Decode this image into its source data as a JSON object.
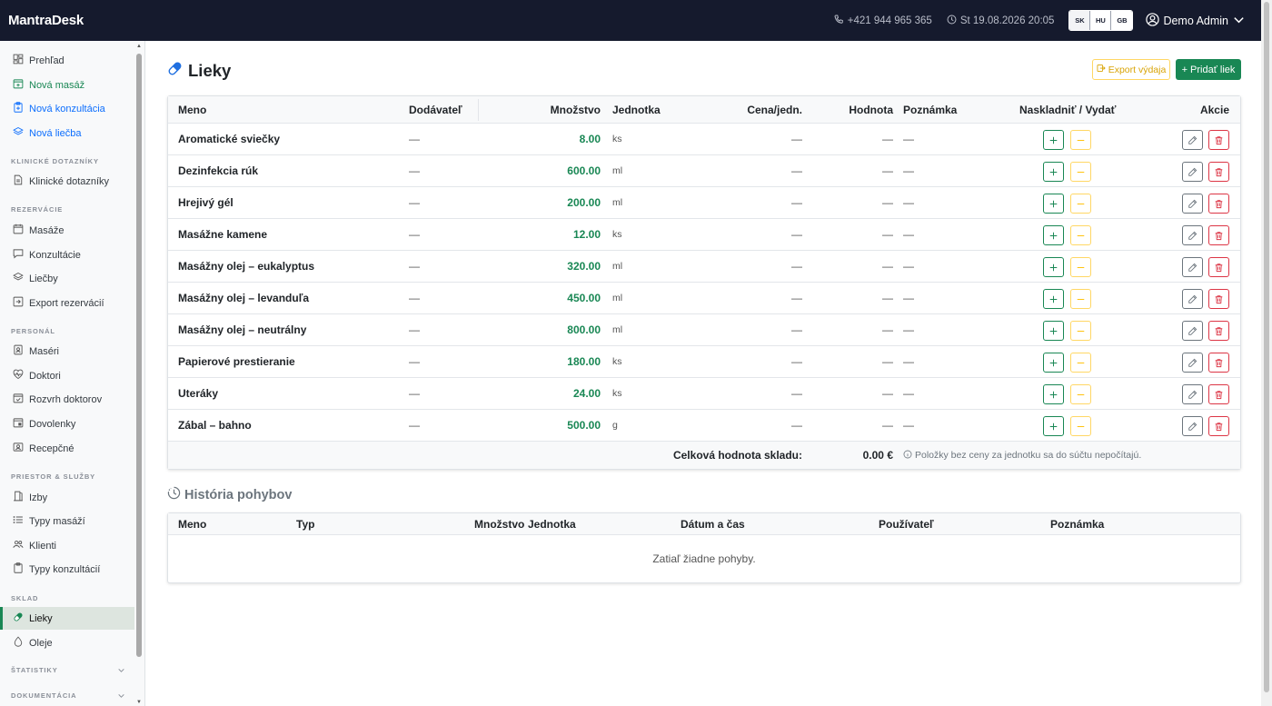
{
  "topbar": {
    "brand": "MantraDesk",
    "phone": "+421 944 965 365",
    "datetime": "St 19.08.2026 20:05",
    "languages": [
      "SK",
      "HU",
      "GB"
    ],
    "user": "Demo Admin"
  },
  "sidebar": {
    "items": [
      {
        "label": "Prehľad",
        "icon": "dashboard-icon"
      },
      {
        "label": "Nová masáž",
        "icon": "calendar-plus-icon"
      },
      {
        "label": "Nová konzultácia",
        "icon": "clipboard-plus-icon"
      },
      {
        "label": "Nová liečba",
        "icon": "layers-icon"
      },
      {
        "label": "Klinické dotazníky",
        "icon": "document-icon"
      },
      {
        "label": "Masáže",
        "icon": "calendar-icon"
      },
      {
        "label": "Konzultácie",
        "icon": "chat-icon"
      },
      {
        "label": "Liečby",
        "icon": "layers-icon"
      },
      {
        "label": "Export rezervácií",
        "icon": "export-icon"
      },
      {
        "label": "Maséri",
        "icon": "person-badge-icon"
      },
      {
        "label": "Doktori",
        "icon": "heart-pulse-icon"
      },
      {
        "label": "Rozvrh doktorov",
        "icon": "calendar-check-icon"
      },
      {
        "label": "Dovolenky",
        "icon": "calendar-event-icon"
      },
      {
        "label": "Recepčné",
        "icon": "person-card-icon"
      },
      {
        "label": "Izby",
        "icon": "door-icon"
      },
      {
        "label": "Typy masáží",
        "icon": "list-icon"
      },
      {
        "label": "Klienti",
        "icon": "people-icon"
      },
      {
        "label": "Typy konzultácií",
        "icon": "clipboard-icon"
      },
      {
        "label": "Lieky",
        "icon": "capsule-icon"
      },
      {
        "label": "Oleje",
        "icon": "droplet-icon"
      }
    ],
    "sections": {
      "clinical": "KLINICKÉ DOTAZNÍKY",
      "reservations": "REZERVÁCIE",
      "staff": "PERSONÁL",
      "premises": "PRIESTOR & SLUŽBY",
      "stock": "SKLAD",
      "stats": "ŠTATISTIKY",
      "docs": "DOKUMENTÁCIA"
    }
  },
  "page": {
    "title": "Lieky",
    "export_label": "Export výdaja",
    "add_label": "+ Pridať liek"
  },
  "table": {
    "headers": {
      "name": "Meno",
      "supplier": "Dodávateľ",
      "quantity": "Množstvo",
      "unit": "Jednotka",
      "unit_price": "Cena/jedn.",
      "value": "Hodnota",
      "note": "Poznámka",
      "stock": "Naskladniť / Vydať",
      "actions": "Akcie"
    },
    "rows": [
      {
        "name": "Aromatické sviečky",
        "supplier": "—",
        "quantity": "8.00",
        "unit": "ks",
        "unit_price": "—",
        "value": "—",
        "note": "—"
      },
      {
        "name": "Dezinfekcia rúk",
        "supplier": "—",
        "quantity": "600.00",
        "unit": "ml",
        "unit_price": "—",
        "value": "—",
        "note": "—"
      },
      {
        "name": "Hrejivý gél",
        "supplier": "—",
        "quantity": "200.00",
        "unit": "ml",
        "unit_price": "—",
        "value": "—",
        "note": "—"
      },
      {
        "name": "Masážne kamene",
        "supplier": "—",
        "quantity": "12.00",
        "unit": "ks",
        "unit_price": "—",
        "value": "—",
        "note": "—"
      },
      {
        "name": "Masážny olej – eukalyptus",
        "supplier": "—",
        "quantity": "320.00",
        "unit": "ml",
        "unit_price": "—",
        "value": "—",
        "note": "—"
      },
      {
        "name": "Masážny olej – levanduľa",
        "supplier": "—",
        "quantity": "450.00",
        "unit": "ml",
        "unit_price": "—",
        "value": "—",
        "note": "—"
      },
      {
        "name": "Masážny olej – neutrálny",
        "supplier": "—",
        "quantity": "800.00",
        "unit": "ml",
        "unit_price": "—",
        "value": "—",
        "note": "—"
      },
      {
        "name": "Papierové prestieranie",
        "supplier": "—",
        "quantity": "180.00",
        "unit": "ks",
        "unit_price": "—",
        "value": "—",
        "note": "—"
      },
      {
        "name": "Uteráky",
        "supplier": "—",
        "quantity": "24.00",
        "unit": "ks",
        "unit_price": "—",
        "value": "—",
        "note": "—"
      },
      {
        "name": "Zábal – bahno",
        "supplier": "—",
        "quantity": "500.00",
        "unit": "g",
        "unit_price": "—",
        "value": "—",
        "note": "—"
      }
    ],
    "total_label": "Celková hodnota skladu:",
    "total_value": "0.00 €",
    "total_note": "Položky bez ceny za jednotku sa do súčtu nepočítajú."
  },
  "history": {
    "title": "História pohybov",
    "headers": {
      "name": "Meno",
      "type": "Typ",
      "quantity": "Množstvo",
      "unit": "Jednotka",
      "datetime": "Dátum a čas",
      "user": "Používateľ",
      "note": "Poznámka"
    },
    "empty": "Zatiaľ žiadne pohyby."
  },
  "colors": {
    "topbar": "#151a2d",
    "primary": "#198754",
    "warning": "#ffc107",
    "danger": "#dc3545"
  }
}
